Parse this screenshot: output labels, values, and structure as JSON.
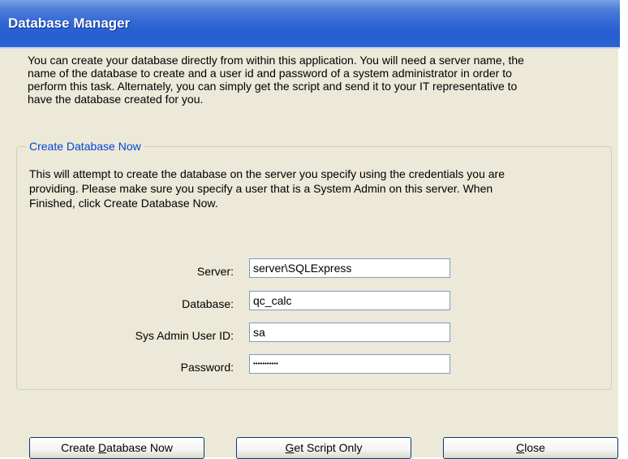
{
  "window": {
    "title": "Database Manager"
  },
  "intro_text": "You can create your database directly from within this application. You will need a server name, the\nname of the database to create and a user id and password of a system administrator in order to\nperform this task. Alternately, you can simply get the script and send it to your IT representative to\nhave the database created for you.",
  "group": {
    "legend": "Create Database Now",
    "description": "This will attempt to create the database on the server you specify using the credentials you are\nproviding. Please make sure you specify a user that is a System Admin on this server. When\nFinished, click Create Database Now."
  },
  "form": {
    "server_label": "Server:",
    "server_value": "server\\SQLExpress",
    "database_label": "Database:",
    "database_value": "qc_calc",
    "userid_label": "Sys Admin User ID:",
    "userid_value": "sa",
    "password_label": "Password:",
    "password_masked": "•••••••••••"
  },
  "buttons": {
    "create": {
      "before": "Create ",
      "mnemonic": "D",
      "after": "atabase Now"
    },
    "script": {
      "before": "",
      "mnemonic": "G",
      "after": "et Script Only"
    },
    "close": {
      "before": "",
      "mnemonic": "C",
      "after": "lose"
    }
  }
}
